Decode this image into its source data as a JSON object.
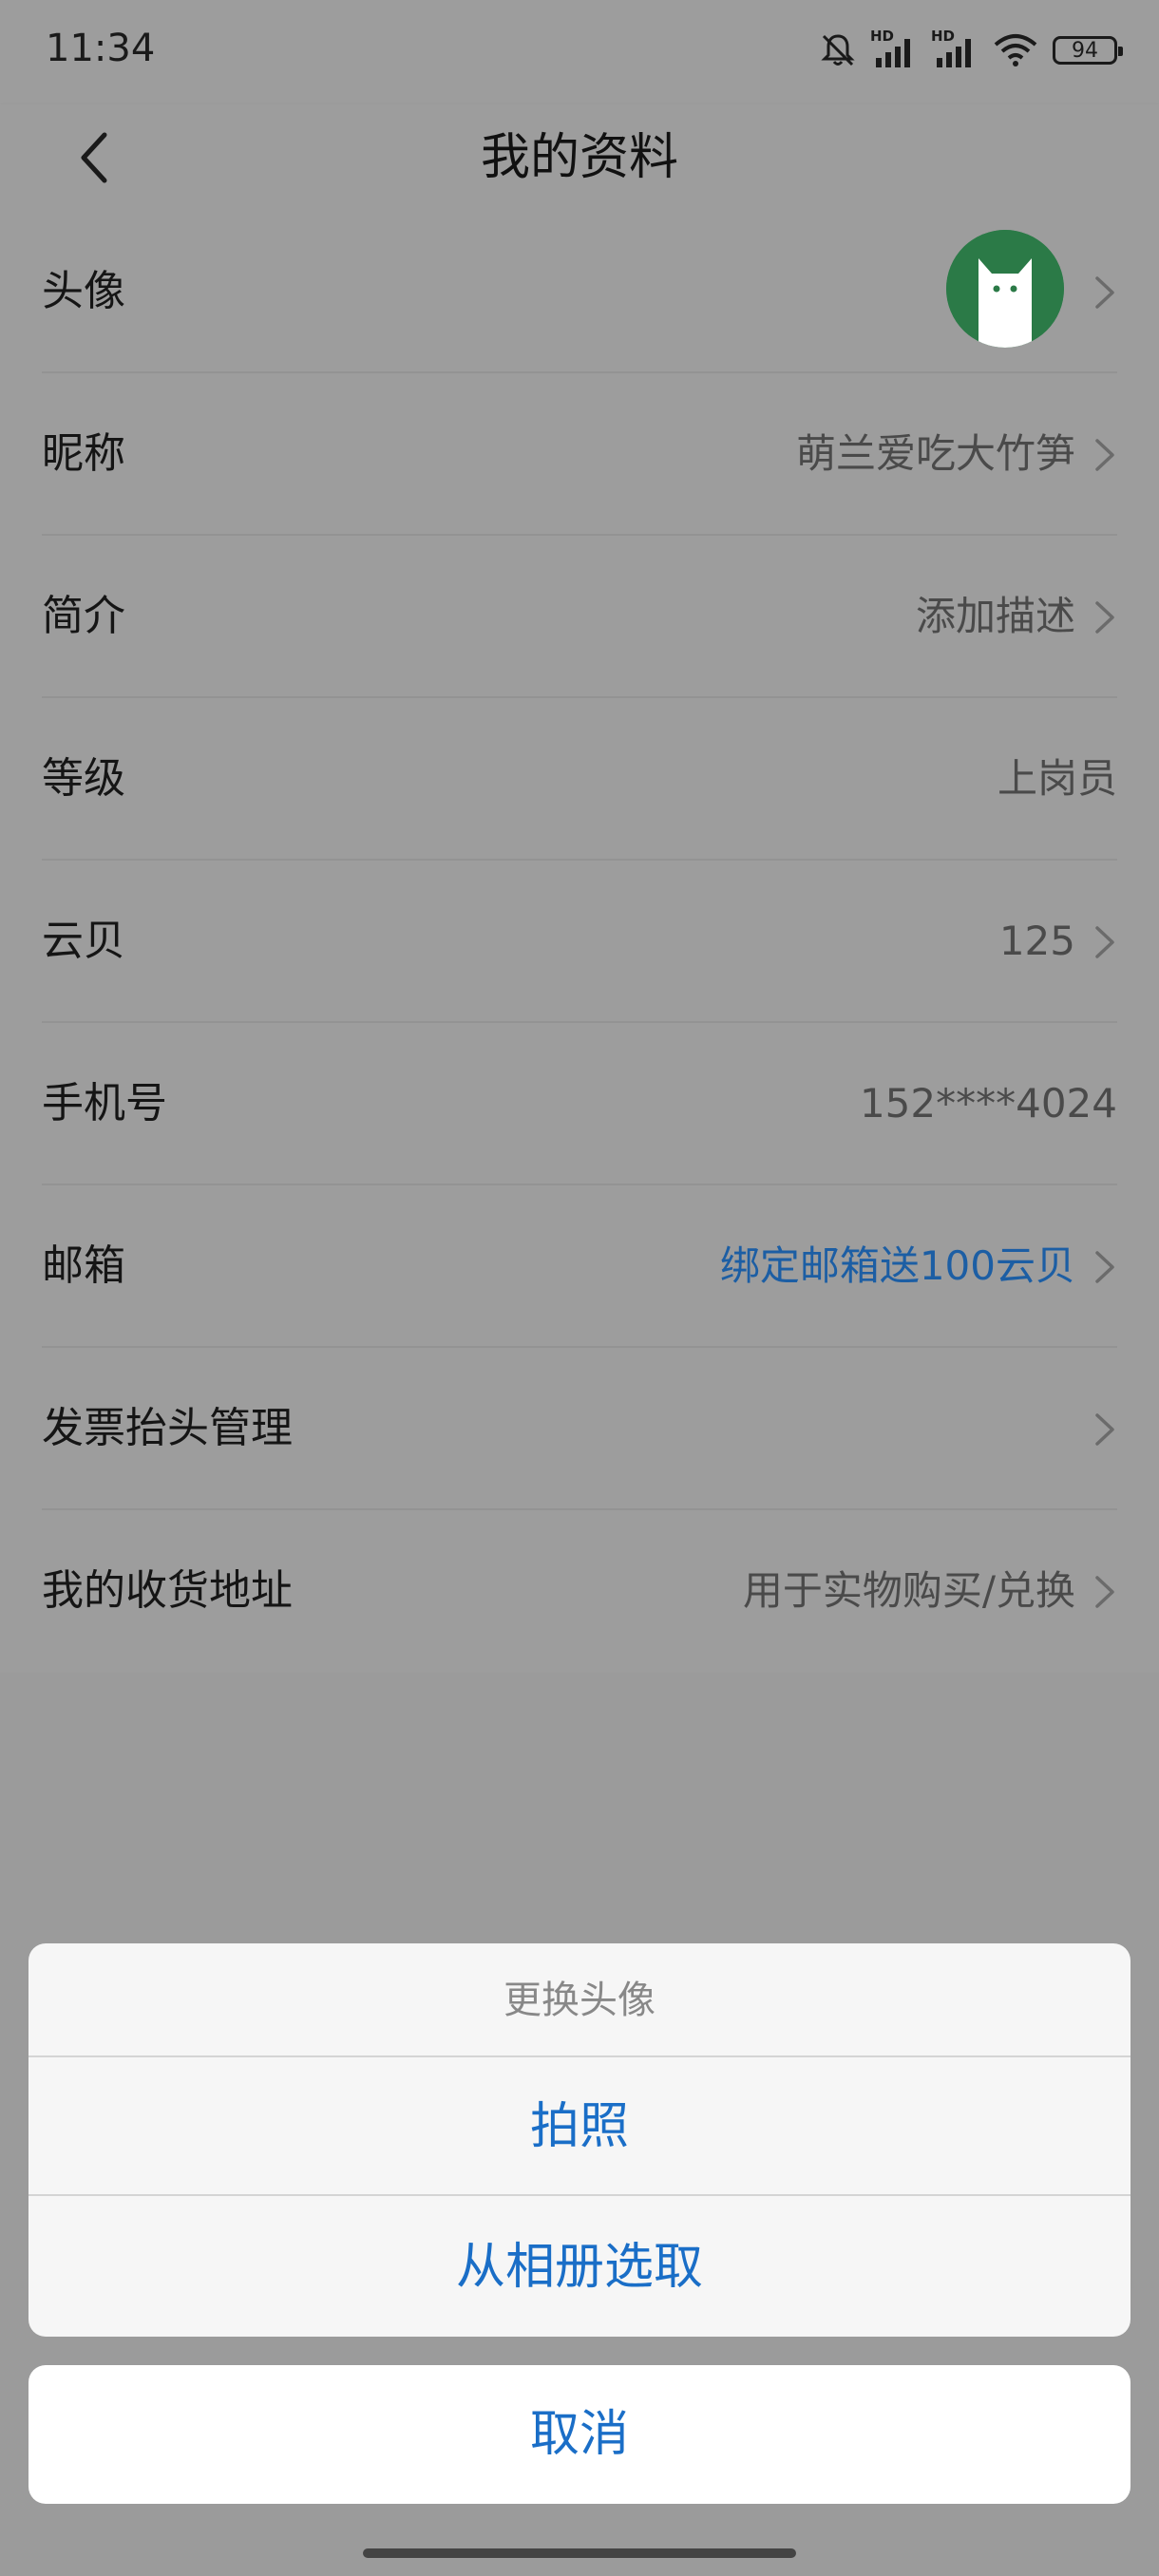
{
  "status": {
    "time": "11:34",
    "battery": "94",
    "hd1": "HD",
    "hd2": "HD"
  },
  "header": {
    "title": "我的资料",
    "back_icon": "chevron-left-icon"
  },
  "profile": {
    "rows": [
      {
        "label": "头像",
        "value": ""
      },
      {
        "label": "昵称",
        "value": "萌兰爱吃大竹笋"
      },
      {
        "label": "简介",
        "value": "添加描述"
      },
      {
        "label": "等级",
        "value": "上岗员"
      },
      {
        "label": "云贝",
        "value": "125"
      },
      {
        "label": "手机号",
        "value": "152****4024"
      },
      {
        "label": "邮箱",
        "value": "绑定邮箱送100云贝"
      },
      {
        "label": "发票抬头管理",
        "value": ""
      },
      {
        "label": "我的收货地址",
        "value": "用于实物购买/兑换"
      }
    ]
  },
  "action_sheet": {
    "title": "更换头像",
    "take_photo": "拍照",
    "choose_album": "从相册选取",
    "cancel": "取消"
  },
  "colors": {
    "accent": "#1a6ec7",
    "link": "#1c5ea4",
    "avatar_bg": "#2b7a47",
    "overlay": "#9b9b9b"
  }
}
